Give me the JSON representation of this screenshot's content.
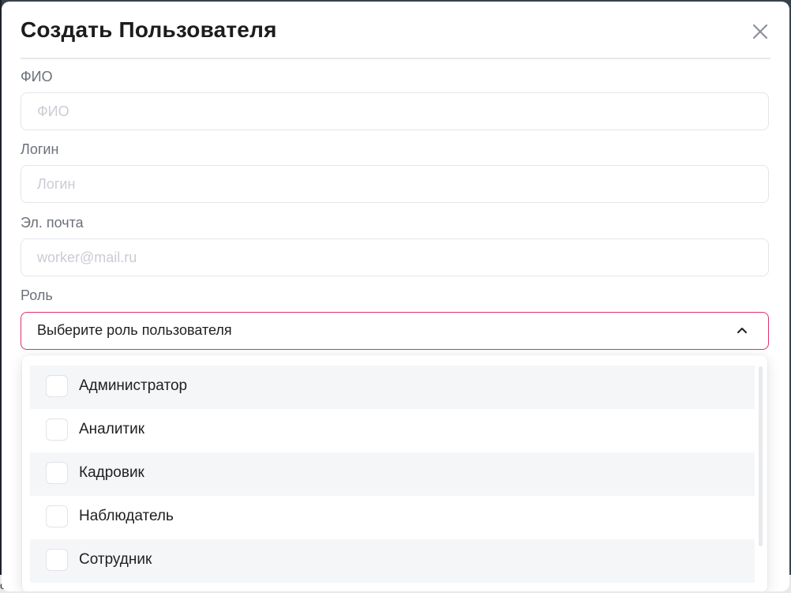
{
  "background": {
    "bottom_text": "ов"
  },
  "modal": {
    "title": "Создать Пользователя",
    "close_icon": "close-icon"
  },
  "form": {
    "full_name": {
      "label": "ФИО",
      "placeholder": "ФИО",
      "value": ""
    },
    "login": {
      "label": "Логин",
      "placeholder": "Логин",
      "value": ""
    },
    "email": {
      "label": "Эл. почта",
      "placeholder": "worker@mail.ru",
      "value": ""
    },
    "role": {
      "label": "Роль",
      "selected_text": "Выберите роль пользователя",
      "chevron_icon": "chevron-up-icon",
      "options": [
        {
          "label": "Администратор",
          "checked": false
        },
        {
          "label": "Аналитик",
          "checked": false
        },
        {
          "label": "Кадровик",
          "checked": false
        },
        {
          "label": "Наблюдатель",
          "checked": false
        },
        {
          "label": "Сотрудник",
          "checked": false
        }
      ]
    }
  },
  "colors": {
    "accent_border": "#e0306f",
    "title_text": "#1c1c1e",
    "label_text": "#6b7079",
    "placeholder_text": "#c9ccd3"
  }
}
